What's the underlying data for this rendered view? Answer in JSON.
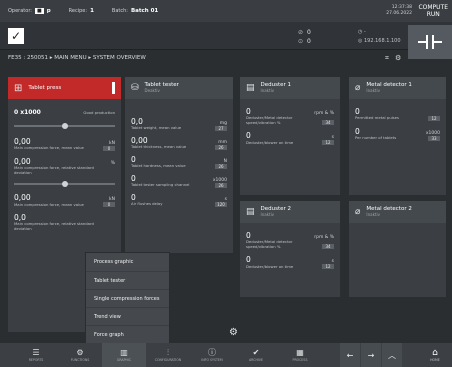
{
  "topbar": {
    "operator_label": "Operator:",
    "operator_value": "p",
    "recipe_label": "Recipe:",
    "recipe_value": "1",
    "batch_label": "Batch:",
    "batch_value": "Batch 01",
    "time": "12:37:38",
    "date": "27.06.2022",
    "brand_line1": "COMPUTE",
    "brand_line2": "RUN"
  },
  "statusbar": {
    "counter1": "0",
    "counter2": "0",
    "status1": "-",
    "status2": "192.168.1.100"
  },
  "breadcrumb": "FE35 : 250051 ▸ MAIN MENU ▸ SYSTEM OVERVIEW",
  "tablet_press": {
    "title": "Tablet press",
    "prod_value": "0 x1000",
    "prod_label": "Good production",
    "comp1_value": "0,00",
    "comp1_unit": "kN",
    "comp1_label": "Main compression force, mean value",
    "comp1_badge": "0",
    "rsd1_value": "0,00",
    "rsd1_unit": "%",
    "rsd1_label": "Main compression force, relative standard deviation",
    "comp2_value": "0,00",
    "comp2_unit": "kN",
    "comp2_label": "Main compression force, mean value",
    "comp2_badge": "0",
    "rsd2_value": "0,0",
    "rsd2_label": "Main compression force, relative standard deviation"
  },
  "tablet_tester": {
    "title": "Tablet tester",
    "sub": "Deaktiv",
    "r1_value": "0,0",
    "r1_unit": "mg",
    "r1_label": "Tablet weight, mean value",
    "r1_badge": "27",
    "r2_value": "0,00",
    "r2_unit": "mm",
    "r2_label": "Tablet thickness, mean value",
    "r2_badge": "26",
    "r3_value": "0",
    "r3_unit": "N",
    "r3_label": "Tablet hardness, mean value",
    "r3_badge": "26",
    "r4_value": "0",
    "r4_unit": "x1000",
    "r4_label": "Tablet tester sampling channel",
    "r4_badge": "26",
    "r5_value": "0",
    "r5_unit": "s",
    "r5_label": "Air flushes delay",
    "r5_badge": "120"
  },
  "deduster1": {
    "title": "Deduster 1",
    "sub": "Inaktiv",
    "r1_value": "0",
    "r1_unit": "rpm & %",
    "r1_label": "Deduster/Metal detector speed/vibration %",
    "r1_badge": "34",
    "r2_value": "0",
    "r2_unit": "s",
    "r2_label": "Deduster/blower on time",
    "r2_badge": "12"
  },
  "metal_detector1": {
    "title": "Metal detector 1",
    "sub": "Inaktiv",
    "r1_value": "0",
    "r1_label": "Permitted metal pulses",
    "r1_badge": "12",
    "r2_value": "0",
    "r2_unit": "x1000",
    "r2_label": "Per number of tablets",
    "r2_badge": "33"
  },
  "deduster2": {
    "title": "Deduster 2",
    "sub": "Inaktiv",
    "r1_value": "0",
    "r1_unit": "rpm & %",
    "r1_label": "Deduster/Metal detector speed/vibration %",
    "r1_badge": "34",
    "r2_value": "0",
    "r2_unit": "s",
    "r2_label": "Deduster/blower on time",
    "r2_badge": "12"
  },
  "metal_detector2": {
    "title": "Metal detector 2",
    "sub": "Inaktiv"
  },
  "popup_menu": {
    "items": [
      "Process graphic",
      "Tablet tester",
      "Single compression forces",
      "Trend view",
      "Force graph"
    ]
  },
  "bottom_nav": {
    "items": [
      {
        "label": "REPORTS",
        "icon": "list-icon"
      },
      {
        "label": "FUNCTIONS",
        "icon": "gear-icon"
      },
      {
        "label": "GRAPHIC",
        "icon": "chart-icon"
      },
      {
        "label": "CONFIGURATION",
        "icon": "config-icon"
      },
      {
        "label": "INFO SYSTEM",
        "icon": "info-icon"
      },
      {
        "label": "ARCHIVE",
        "icon": "check-icon"
      },
      {
        "label": "PROCESS",
        "icon": "grid-icon"
      }
    ],
    "home_label": "HOME"
  },
  "colors": {
    "accent_red": "#c22a2a",
    "background": "#2b2e31",
    "card": "#3b3f43"
  }
}
